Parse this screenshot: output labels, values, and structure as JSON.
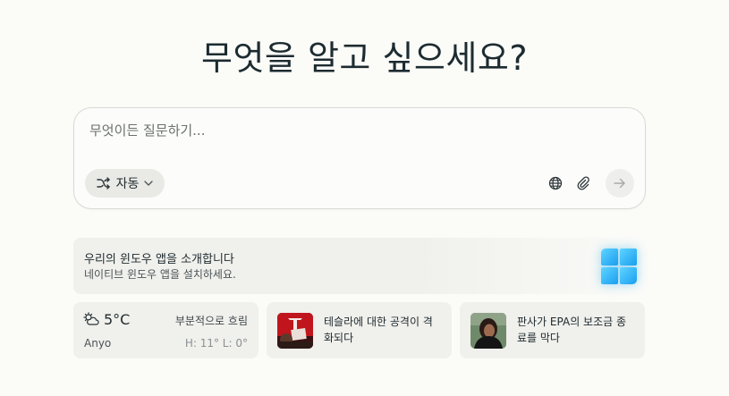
{
  "title": "무엇을 알고 싶으세요?",
  "composer": {
    "placeholder": "무엇이든 질문하기...",
    "mode_label": "자동"
  },
  "promo": {
    "title": "우리의 윈도우 앱을 소개합니다",
    "subtitle": "네이티브 윈도우 앱을 설치하세요."
  },
  "weather": {
    "temperature": "5°C",
    "condition": "부분적으로 흐림",
    "location": "Anyo",
    "high_low": "H: 11° L: 0°"
  },
  "news": [
    {
      "headline": "테슬라에 대한 공격이 격화되다"
    },
    {
      "headline": "판사가 EPA의 보조금 종료를 막다"
    }
  ],
  "icons": {
    "mode": "shuffle-icon",
    "mode_caret": "chevron-down-icon",
    "globe": "globe-icon",
    "attach": "paperclip-icon",
    "send": "arrow-right-icon",
    "weather": "partly-cloudy-icon",
    "promo": "windows-logo-icon"
  },
  "colors": {
    "background": "#fbfbf8",
    "card": "#f0f0ec",
    "text": "#1f2a2e",
    "windows_blue": "#1a9ef0"
  }
}
